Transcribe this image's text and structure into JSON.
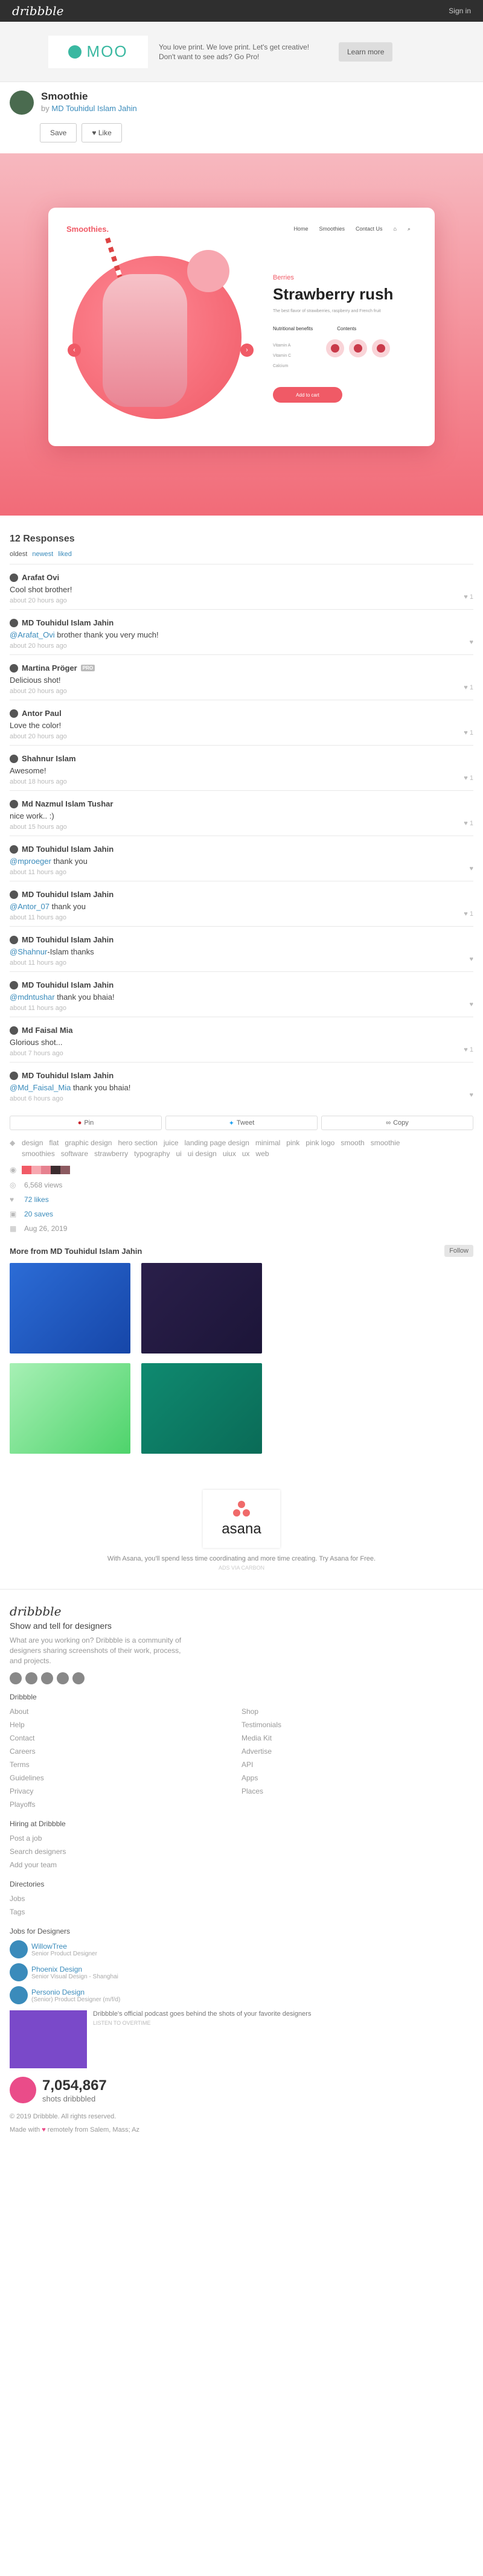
{
  "topbar": {
    "logo": "dribbble",
    "signin": "Sign in"
  },
  "ad": {
    "brand": "MOO",
    "text": "You love print. We love print. Let's get creative!",
    "subtext": "Don't want to see ads? Go Pro!",
    "button": "Learn more"
  },
  "shot": {
    "title": "Smoothie",
    "by_prefix": "by",
    "author": "MD Touhidul Islam Jahin",
    "save": "Save",
    "like": "Like"
  },
  "mockup": {
    "brand": "Smoothies.",
    "nav": [
      "Home",
      "Smoothies",
      "Contact Us"
    ],
    "category": "Berries",
    "name": "Strawberry rush",
    "description": "The best flavor of strawberries, raspberry and French fruit",
    "labels": [
      "Nutritional benefits",
      "Contents"
    ],
    "list": [
      "Vitamin A",
      "Vitamin C",
      "Calcium"
    ],
    "button": "Add to cart"
  },
  "responses": {
    "title": "12 Responses",
    "sorts": [
      "oldest",
      "newest",
      "liked"
    ],
    "items": [
      {
        "name": "Arafat Ovi",
        "text": "Cool shot brother!",
        "time": "about 20 hours ago",
        "likes": "1",
        "mention": ""
      },
      {
        "name": "MD Touhidul Islam Jahin",
        "mention": "@Arafat_Ovi",
        "text": " brother thank you very much!",
        "time": "about 20 hours ago",
        "likes": ""
      },
      {
        "name": "Martina Pröger",
        "badge": "PRO",
        "text": "Delicious shot!",
        "time": "about 20 hours ago",
        "likes": "1",
        "mention": ""
      },
      {
        "name": "Antor Paul",
        "text": "Love the color!",
        "time": "about 20 hours ago",
        "likes": "1",
        "mention": ""
      },
      {
        "name": "Shahnur Islam",
        "text": "Awesome!",
        "time": "about 18 hours ago",
        "likes": "1",
        "mention": ""
      },
      {
        "name": "Md Nazmul Islam Tushar",
        "text": "nice work.. :)",
        "time": "about 15 hours ago",
        "likes": "1",
        "mention": ""
      },
      {
        "name": "MD Touhidul Islam Jahin",
        "mention": "@mproeger",
        "text": " thank you",
        "time": "about 11 hours ago",
        "likes": ""
      },
      {
        "name": "MD Touhidul Islam Jahin",
        "mention": "@Antor_07",
        "text": " thank you",
        "time": "about 11 hours ago",
        "likes": "1"
      },
      {
        "name": "MD Touhidul Islam Jahin",
        "mention": "@Shahnur",
        "text": "-Islam thanks",
        "time": "about 11 hours ago",
        "likes": ""
      },
      {
        "name": "MD Touhidul Islam Jahin",
        "mention": "@mdntushar",
        "text": " thank you bhaia!",
        "time": "about 11 hours ago",
        "likes": ""
      },
      {
        "name": "Md Faisal Mia",
        "text": "Glorious shot...",
        "time": "about 7 hours ago",
        "likes": "1",
        "mention": ""
      },
      {
        "name": "MD Touhidul Islam Jahin",
        "mention": "@Md_Faisal_Mia",
        "text": " thank you bhaia!",
        "time": "about 6 hours ago",
        "likes": ""
      }
    ]
  },
  "share": {
    "pin": "Pin",
    "tweet": "Tweet",
    "copy": "Copy"
  },
  "tags": [
    "design",
    "flat",
    "graphic design",
    "hero section",
    "juice",
    "landing page design",
    "minimal",
    "pink",
    "pink logo",
    "smooth",
    "smoothie",
    "smoothies",
    "software",
    "strawberry",
    "typography",
    "ui",
    "ui design",
    "uiux",
    "ux",
    "web"
  ],
  "palette": [
    "#f15a66",
    "#f7a8b0",
    "#e6818f",
    "#3b2b2e",
    "#8c5a60",
    "#ffffff"
  ],
  "meta": {
    "views": "6,568 views",
    "likes": "72 likes",
    "saves": "20 saves",
    "date": "Aug 26, 2019"
  },
  "more": {
    "title": "More from MD Touhidul Islam Jahin",
    "follow": "Follow"
  },
  "asana": {
    "brand": "asana",
    "text": "With Asana, you'll spend less time coordinating and more time creating. Try Asana for Free.",
    "note": "ADS VIA CARBON"
  },
  "footer": {
    "logo": "dribbble",
    "tagline": "Show and tell for designers",
    "description": "What are you working on? Dribbble is a community of designers sharing screenshots of their work, process, and projects.",
    "dribbble_title": "Dribbble",
    "col1": [
      "About",
      "Help",
      "Contact",
      "Careers",
      "Terms",
      "Guidelines",
      "Privacy",
      "Playoffs"
    ],
    "col2": [
      "Shop",
      "Testimonials",
      "Media Kit",
      "Advertise",
      "API",
      "Apps",
      "Places"
    ],
    "hiring_title": "Hiring at Dribbble",
    "hiring": [
      "Post a job",
      "Search designers",
      "Add your team"
    ],
    "dirs_title": "Directories",
    "dirs": [
      "Jobs",
      "Tags"
    ],
    "jobs_title": "Jobs for Designers",
    "jobs": [
      {
        "company": "WillowTree",
        "role": "Senior Product Designer"
      },
      {
        "company": "Phoenix Design",
        "role": "Senior Visual Design - Shanghai"
      },
      {
        "company": "Personio Design",
        "role": "(Senior) Product Designer (m/f/d)"
      }
    ],
    "podcast": "Dribbble's official podcast goes behind the shots of your favorite designers",
    "podcast_link": "LISTEN TO OVERTIME",
    "shots_count": "7,054,867",
    "shots_label": "shots dribbbled",
    "copyright": "© 2019 Dribbble. All rights reserved.",
    "made": "Made with",
    "remotely": "remotely from",
    "cities": "Salem, Mass; Az"
  }
}
